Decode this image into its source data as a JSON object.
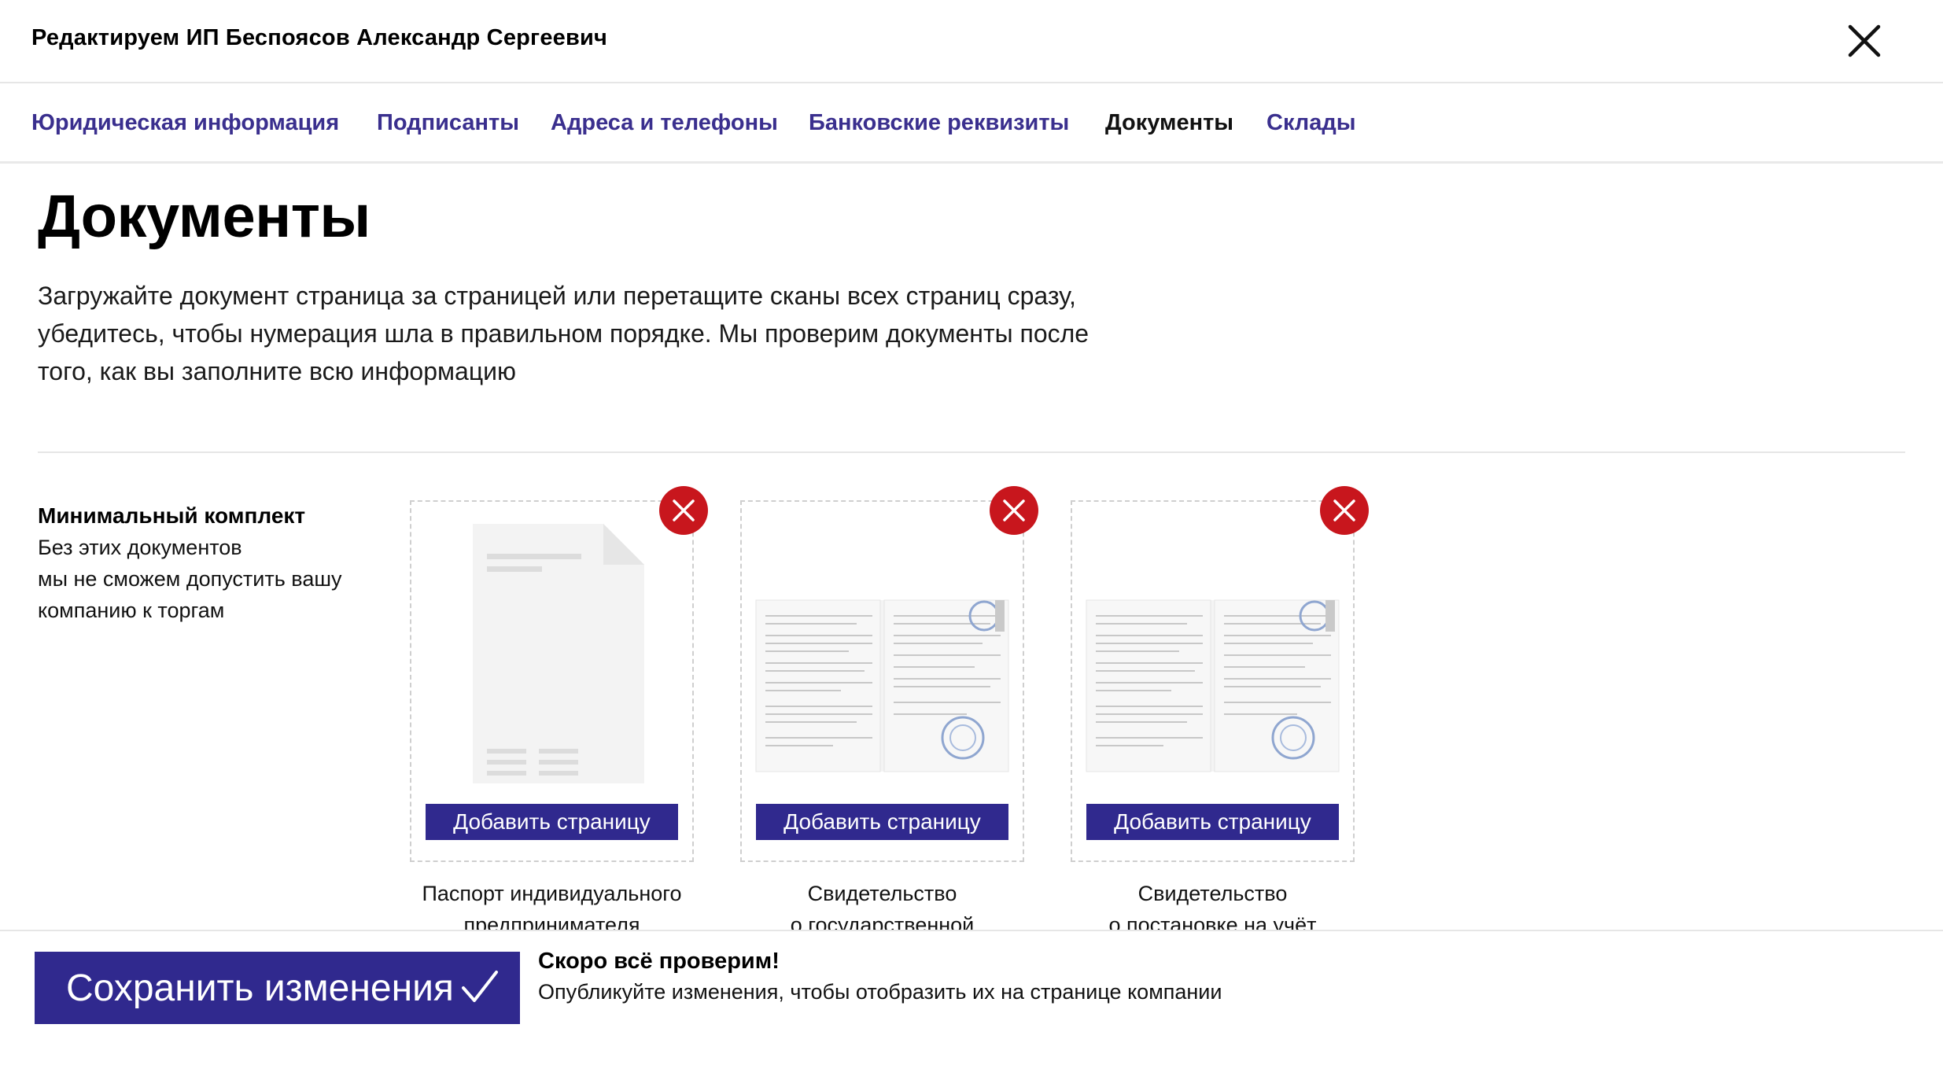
{
  "header": {
    "title": "Редактируем ИП Беспоясов Александр Сергеевич",
    "close_icon": "close-icon"
  },
  "tabs": [
    {
      "label": "Юридическая информация",
      "active": false
    },
    {
      "label": "Подписанты",
      "active": false
    },
    {
      "label": "Адреса и телефоны",
      "active": false
    },
    {
      "label": "Банковские реквизиты",
      "active": false
    },
    {
      "label": "Документы",
      "active": true
    },
    {
      "label": "Склады",
      "active": false
    }
  ],
  "page": {
    "heading": "Документы",
    "intro_lines": [
      "Загружайте документ страница за страницей или перетащите сканы всех страниц сразу,",
      "убедитесь, чтобы нумерация шла в правильном порядке. Мы проверим документы после",
      "того, как вы заполните всю информацию"
    ]
  },
  "kit": {
    "title": "Минимальный комплект",
    "desc_lines": [
      "Без этих документов",
      "мы не сможем допустить вашу",
      "компанию к торгам"
    ]
  },
  "documents": [
    {
      "preview": "blank-document-icon",
      "add_label": "Добавить страницу",
      "caption_lines": [
        "Паспорт индивидуального",
        "предпринимателя"
      ]
    },
    {
      "preview": "scanned-pages-thumbnail",
      "add_label": "Добавить страницу",
      "caption_lines": [
        "Свидетельство",
        "о государственной"
      ]
    },
    {
      "preview": "scanned-pages-thumbnail",
      "add_label": "Добавить страницу",
      "caption_lines": [
        "Свидетельство",
        "о постановке на учёт"
      ]
    }
  ],
  "footer": {
    "save_label": "Сохранить изменения",
    "save_icon": "checkmark-icon",
    "notice_title": "Скоро всё проверим!",
    "notice_text": "Опубликуйте изменения, чтобы отобразить их на странице компании"
  },
  "colors": {
    "accent": "#30298e",
    "tab_link": "#3a2f8e",
    "delete": "#c8161d",
    "divider": "#e6e6e6"
  }
}
